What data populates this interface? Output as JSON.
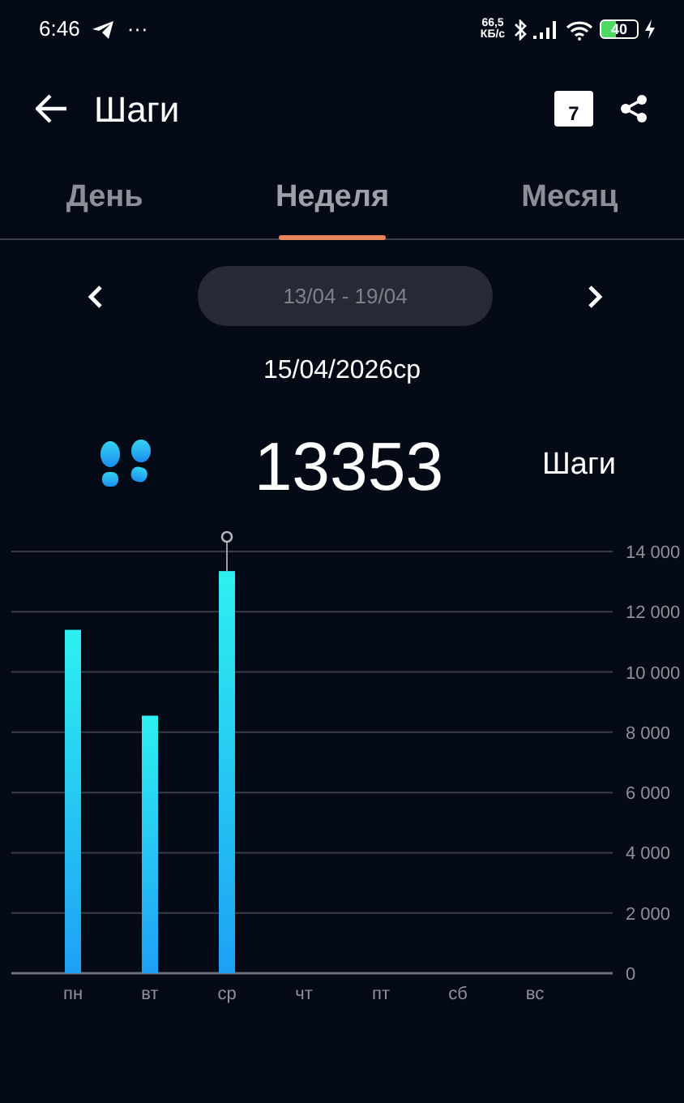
{
  "status_bar": {
    "time": "6:46",
    "dots": "···",
    "speed": "66,5 КБ/с",
    "battery": "40"
  },
  "app_bar": {
    "title": "Шаги",
    "calendar_day": "7"
  },
  "tabs": [
    {
      "label": "День",
      "selected": false
    },
    {
      "label": "Неделя",
      "selected": true
    },
    {
      "label": "Месяц",
      "selected": false
    }
  ],
  "period": {
    "range": "13/04 - 19/04"
  },
  "selected_date": "15/04/2026ср",
  "summary": {
    "value": "13353",
    "unit": "Шаги"
  },
  "chart": {
    "chart_data": {
      "type": "bar",
      "categories": [
        "пн",
        "вт",
        "ср",
        "чт",
        "пт",
        "сб",
        "вс"
      ],
      "series": [
        {
          "color": "#1ea0f5",
          "values": [
            11400,
            8550,
            13350,
            null,
            null,
            null,
            null
          ]
        }
      ],
      "ylim": [
        0,
        14000
      ],
      "yticks": [
        {
          "value": 0,
          "label": "0"
        },
        {
          "value": 2000,
          "label": "2 000"
        },
        {
          "value": 4000,
          "label": "4 000"
        },
        {
          "value": 6000,
          "label": "6 000"
        },
        {
          "value": 8000,
          "label": "8 000"
        },
        {
          "value": 10000,
          "label": "10 000"
        },
        {
          "value": 12000,
          "label": "12 000"
        },
        {
          "value": 14000,
          "label": "14 000"
        }
      ],
      "grid": true
    }
  }
}
